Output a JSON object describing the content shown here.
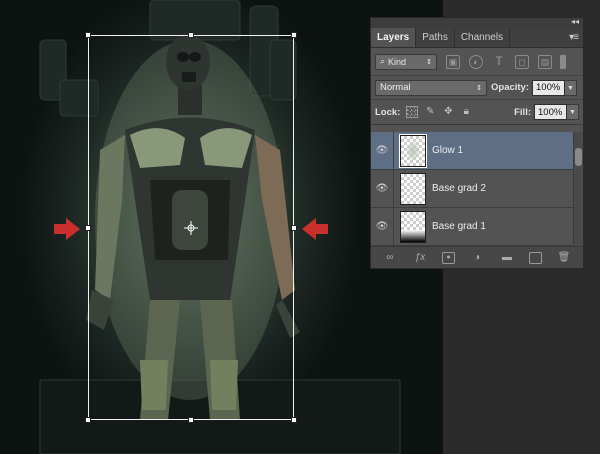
{
  "panel": {
    "collapse_glyph": "◂◂",
    "tabs": [
      {
        "label": "Layers",
        "active": true
      },
      {
        "label": "Paths",
        "active": false
      },
      {
        "label": "Channels",
        "active": false
      }
    ],
    "menu_glyph": "▾≡",
    "filter": {
      "kind_label": "Kind",
      "icons": [
        "image-filter-icon",
        "adjustment-filter-icon",
        "type-filter-icon",
        "shape-filter-icon",
        "smart-object-filter-icon"
      ]
    },
    "blend_mode": "Normal",
    "opacity_label": "Opacity:",
    "opacity_value": "100%",
    "lock_label": "Lock:",
    "fill_label": "Fill:",
    "fill_value": "100%",
    "layers": [
      {
        "name": "Glow 1",
        "selected": true,
        "thumb": "glow"
      },
      {
        "name": "Base grad 2",
        "selected": false,
        "thumb": "transparent"
      },
      {
        "name": "Base grad 1",
        "selected": false,
        "thumb": "gradient"
      }
    ],
    "bottom_icons": [
      "link-icon",
      "fx-icon",
      "mask-icon",
      "adjustment-icon",
      "folder-icon",
      "new-layer-icon",
      "trash-icon"
    ]
  },
  "colors": {
    "panel_bg": "#535353",
    "selected_layer": "#5e6e85",
    "arrow_red": "#c9302c"
  }
}
